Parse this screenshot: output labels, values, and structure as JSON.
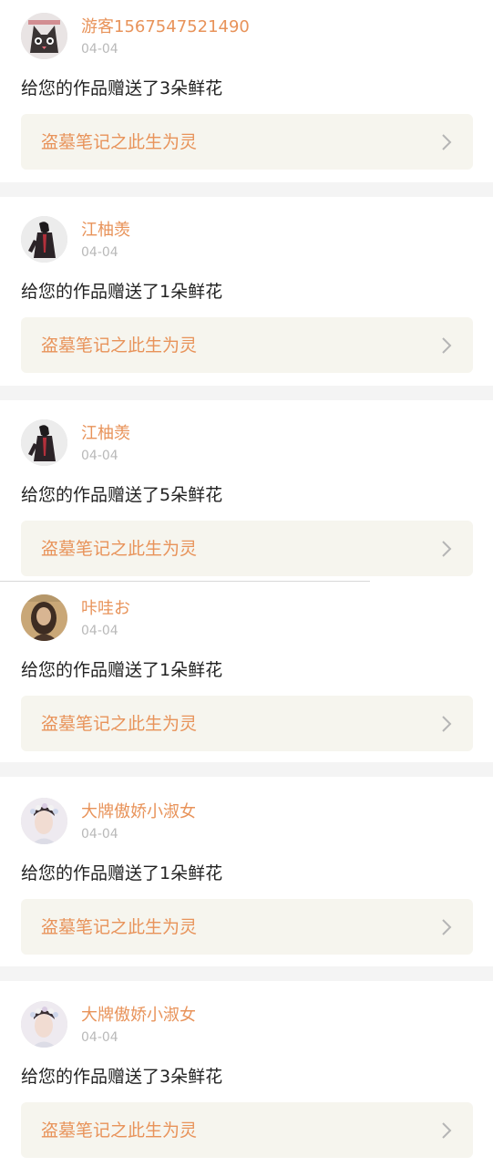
{
  "notifications": [
    {
      "avatar_icon": "cat-avatar-icon",
      "username": "游客1567547521490",
      "date": "04-04",
      "message": "给您的作品赠送了3朵鲜花",
      "work_title": "盗墓笔记之此生为灵"
    },
    {
      "avatar_icon": "figure-avatar-icon",
      "username": "江柚羡",
      "date": "04-04",
      "message": "给您的作品赠送了1朵鲜花",
      "work_title": "盗墓笔记之此生为灵"
    },
    {
      "avatar_icon": "figure-avatar-icon",
      "username": "江柚羡",
      "date": "04-04",
      "message": "给您的作品赠送了5朵鲜花",
      "work_title": "盗墓笔记之此生为灵"
    },
    {
      "avatar_icon": "girl-avatar-icon",
      "username": "咔哇お",
      "date": "04-04",
      "message": "给您的作品赠送了1朵鲜花",
      "work_title": "盗墓笔记之此生为灵"
    },
    {
      "avatar_icon": "flower-crown-avatar-icon",
      "username": "大牌傲娇小淑女",
      "date": "04-04",
      "message": "给您的作品赠送了1朵鲜花",
      "work_title": "盗墓笔记之此生为灵"
    },
    {
      "avatar_icon": "flower-crown-avatar-icon",
      "username": "大牌傲娇小淑女",
      "date": "04-04",
      "message": "给您的作品赠送了3朵鲜花",
      "work_title": "盗墓笔记之此生为灵"
    }
  ],
  "colors": {
    "accent": "#e8935a",
    "date_gray": "#b9b9b9",
    "link_bg": "#f6f5ee",
    "separator": "#f4f4f4"
  }
}
